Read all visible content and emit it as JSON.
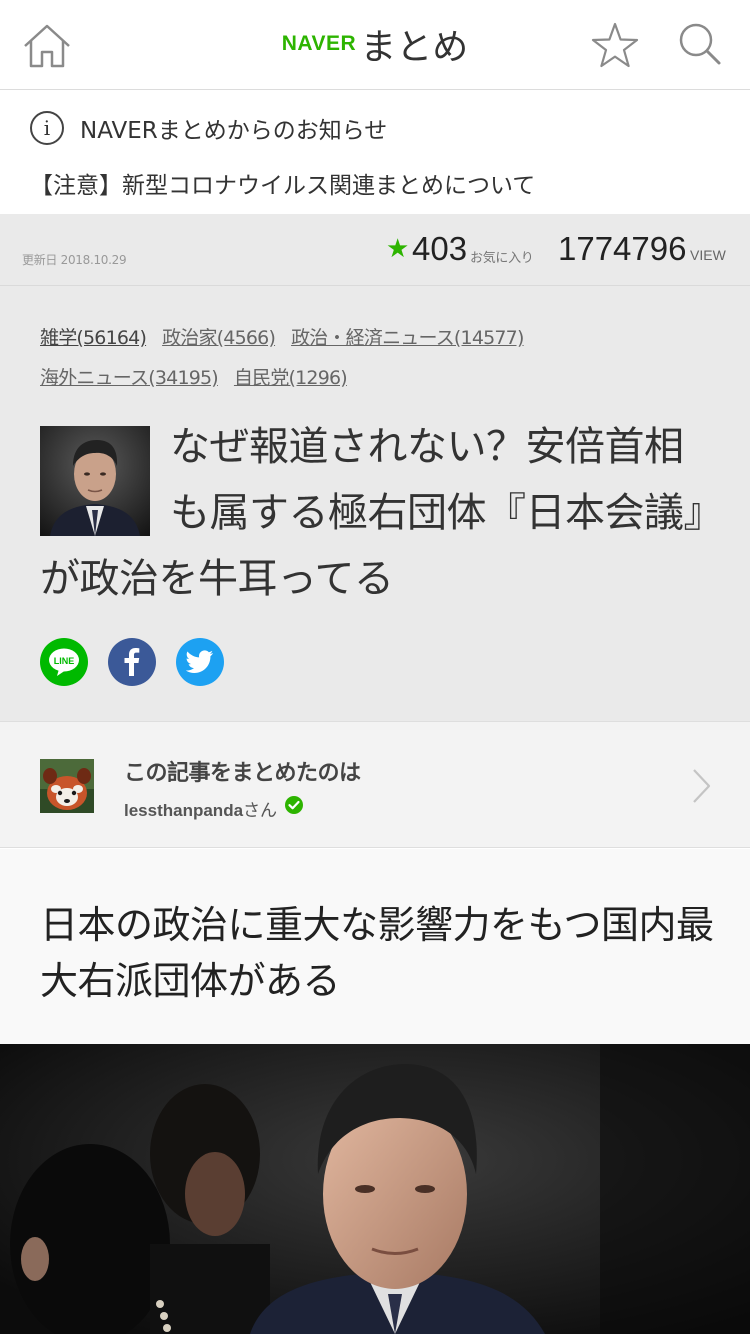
{
  "header": {
    "logo_naver": "NAVER",
    "logo_matome": "まとめ",
    "icons": [
      "home-icon",
      "star-icon",
      "search-icon"
    ]
  },
  "notice": {
    "title": "NAVERまとめからのお知らせ",
    "link": "【注意】新型コロナウイルス関連まとめについて"
  },
  "stats": {
    "updated": "更新日 2018.10.29",
    "favorites": "403",
    "favorites_label": "お気に入り",
    "views": "1774796",
    "views_label": "VIEW"
  },
  "tags": [
    "雑学(56164)",
    "政治家(4566)",
    "政治・経済ニュース(14577)",
    "海外ニュース(34195)",
    "自民党(1296)"
  ],
  "article": {
    "title": "なぜ報道されない？安倍首相も属する極右団体『日本会議』が政治を牛耳ってる"
  },
  "share": {
    "line_label": "LINE",
    "icons": [
      "line-icon",
      "facebook-icon",
      "twitter-icon"
    ]
  },
  "author": {
    "heading": "この記事をまとめたのは",
    "name": "lessthanpanda",
    "suffix": "さん"
  },
  "section": {
    "title": "日本の政治に重大な影響力をもつ国内最大右派団体がある"
  },
  "colors": {
    "brand_green": "#2db400",
    "facebook": "#3b5998",
    "twitter": "#1da1f2",
    "line": "#00b900"
  }
}
